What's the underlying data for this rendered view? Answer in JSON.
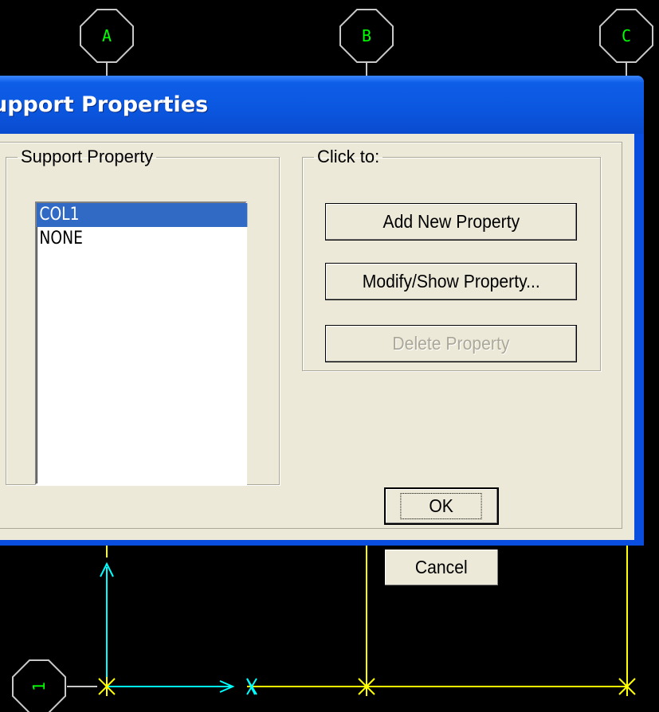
{
  "drawing": {
    "grid_bubbles": [
      "A",
      "B",
      "C",
      "1"
    ]
  },
  "dialog": {
    "title": "upport Properties",
    "support_group": {
      "legend": "Support Property",
      "items": [
        {
          "label": "COL1",
          "selected": true
        },
        {
          "label": "NONE",
          "selected": false
        }
      ]
    },
    "click_group": {
      "legend": "Click to:",
      "add_label": "Add New Property",
      "modify_label": "Modify/Show Property...",
      "delete_label": "Delete Property"
    },
    "ok_label": "OK",
    "cancel_label": "Cancel"
  },
  "colors": {
    "background": "#000000",
    "bubble_text": "#00ff00",
    "gridline_yellow": "#ffff00",
    "axis_cyan": "#00ffff",
    "titlebar_blue": "#0b57e0",
    "dialog_face": "#ece9d8",
    "selection": "#316ac5"
  }
}
